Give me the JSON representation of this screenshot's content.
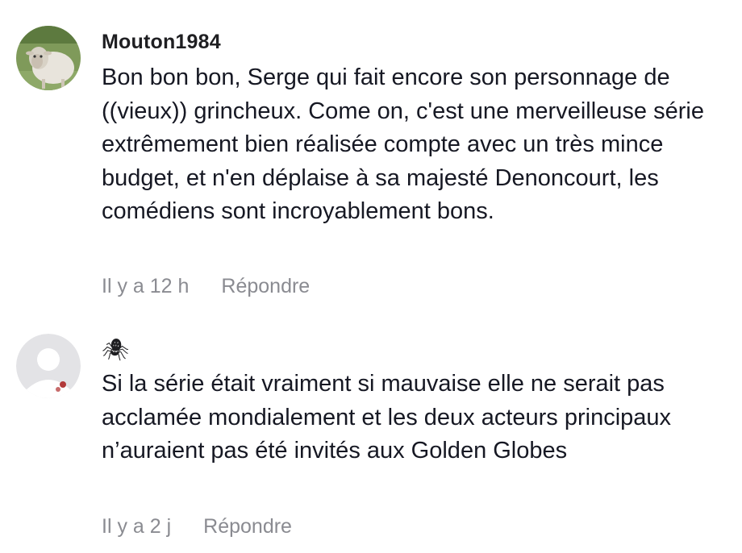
{
  "comments": [
    {
      "username": "Mouton1984",
      "text": "Bon bon bon, Serge qui fait encore son personnage de ((vieux)) grincheux. Come on, c'est une merveilleuse série extrêmement bien réalisée compte avec un très mince budget, et n'en déplaise à sa majesté Denoncourt, les comédiens sont incroyablement bons.",
      "time": "Il y a 12 h",
      "reply_label": "Répondre",
      "avatar_icon": "sheep-avatar"
    },
    {
      "username": "🕷",
      "text": "Si la série était vraiment si mauvaise elle ne serait pas acclamée mondialement et les deux acteurs principaux n’auraient pas été invités aux Golden Globes",
      "time": "Il y a 2 j",
      "reply_label": "Répondre",
      "avatar_icon": "default-user-avatar"
    }
  ]
}
